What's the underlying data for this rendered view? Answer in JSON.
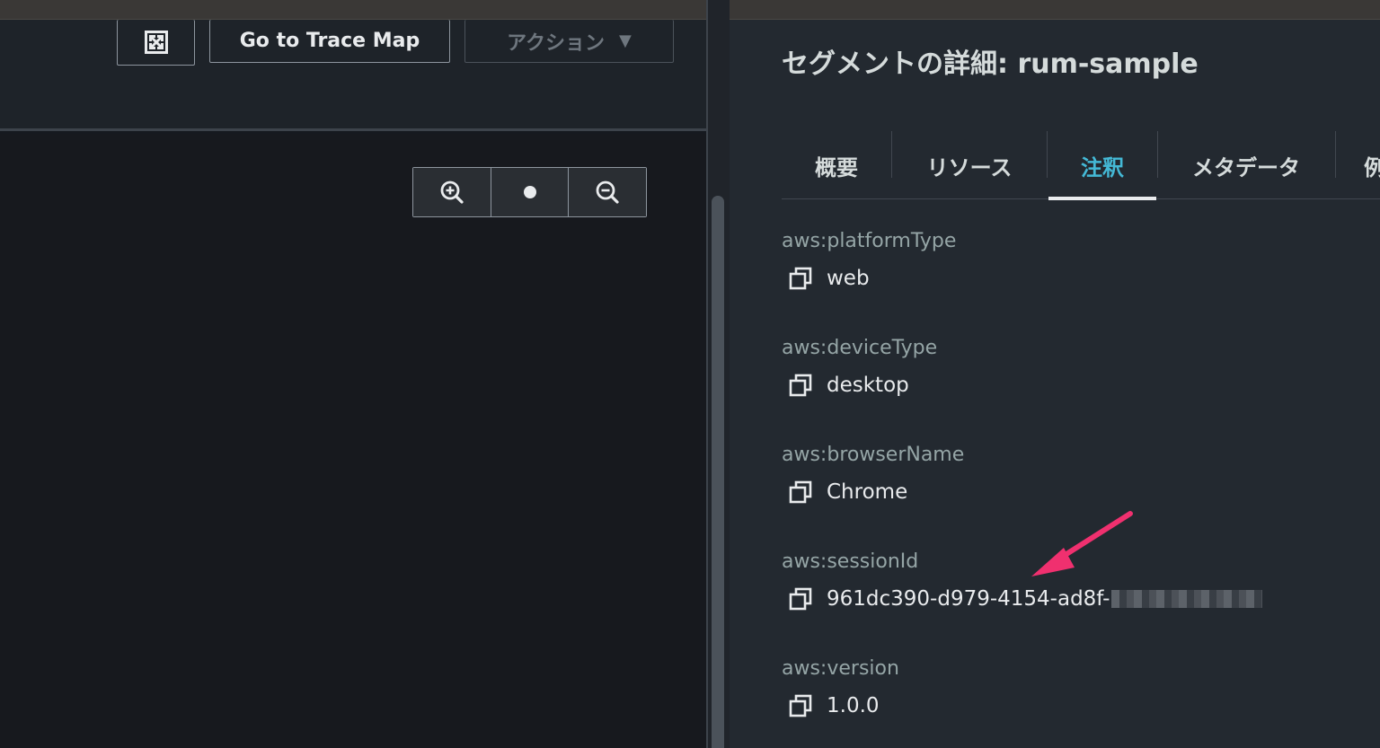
{
  "toolbar": {
    "trace_map_label": "Go to Trace Map",
    "actions_label": "アクション",
    "actions_caret": "▼"
  },
  "icons": {
    "fullscreen": "fullscreen-icon",
    "zoom_in": "zoom-in-icon",
    "reset": "dot-icon",
    "zoom_out": "zoom-out-icon",
    "copy": "copy-icon",
    "annotation_arrow": "pointer-arrow-icon"
  },
  "details": {
    "title": "セグメントの詳細: rum-sample",
    "tabs": [
      {
        "label": "概要",
        "active": false
      },
      {
        "label": "リソース",
        "active": false
      },
      {
        "label": "注釈",
        "active": true
      },
      {
        "label": "メタデータ",
        "active": false
      },
      {
        "label": "例",
        "active": false
      }
    ],
    "annotations": [
      {
        "key": "aws:platformType",
        "value": "web"
      },
      {
        "key": "aws:deviceType",
        "value": "desktop"
      },
      {
        "key": "aws:browserName",
        "value": "Chrome"
      },
      {
        "key": "aws:sessionId",
        "value": "961dc390-d979-4154-ad8f-"
      },
      {
        "key": "aws:version",
        "value": "1.0.0"
      }
    ]
  },
  "colors": {
    "accent_tab": "#44b9d6",
    "annotation_arrow": "#f0306f",
    "panel_bg": "#232930",
    "canvas_bg": "#17191e"
  }
}
